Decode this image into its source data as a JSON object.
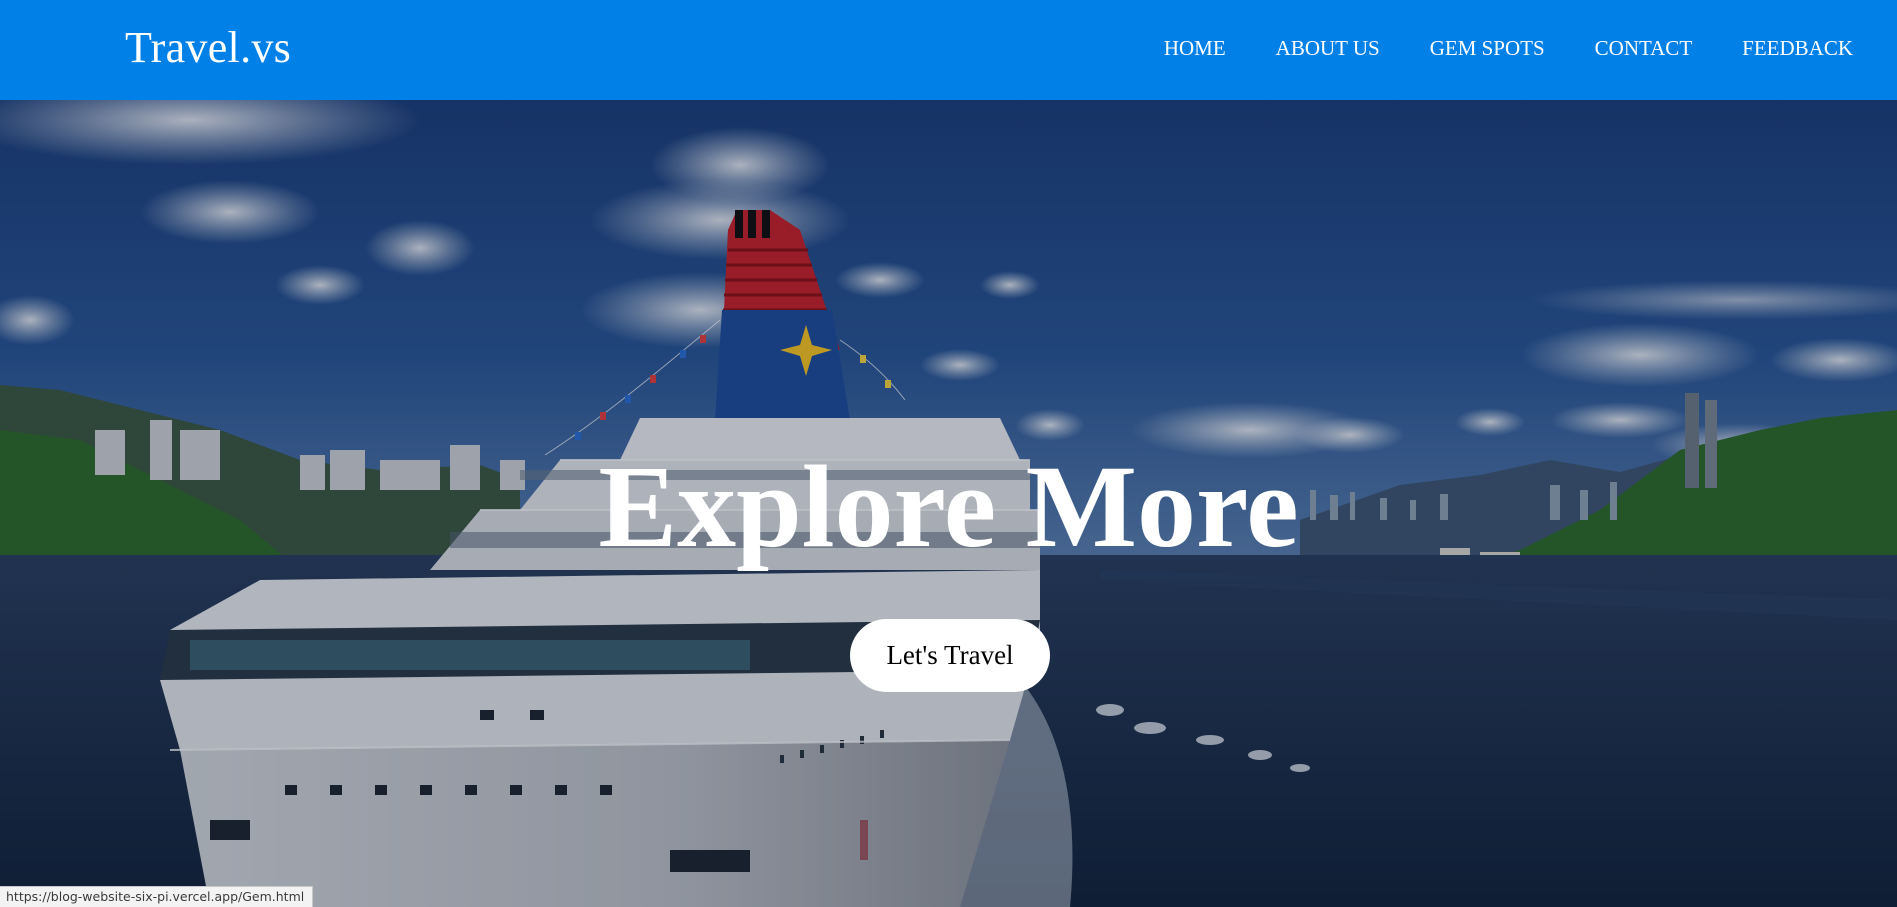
{
  "header": {
    "brand": "Travel.vs",
    "nav": [
      {
        "label": "HOME"
      },
      {
        "label": "ABOUT US"
      },
      {
        "label": "GEM SPOTS"
      },
      {
        "label": "CONTACT"
      },
      {
        "label": "FEEDBACK"
      }
    ]
  },
  "hero": {
    "title": "Explore More",
    "cta_label": "Let's Travel"
  },
  "status_bar": {
    "url": "https://blog-website-six-pi.vercel.app/Gem.html"
  },
  "colors": {
    "navbar": "#0181e8",
    "text": "#ffffff",
    "cta_bg": "#ffffff"
  }
}
